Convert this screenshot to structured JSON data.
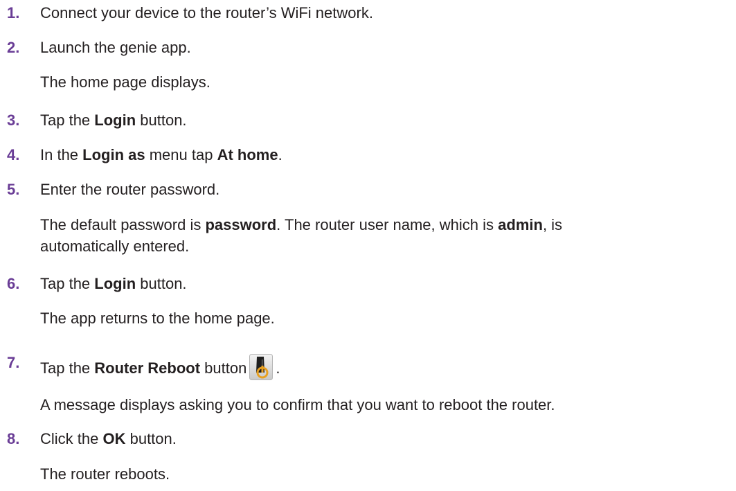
{
  "steps": [
    {
      "num": "1.",
      "parts": [
        "Connect your device to the router’s WiFi network."
      ]
    },
    {
      "num": "2.",
      "parts": [
        "Launch the genie app."
      ],
      "note": "The home page displays."
    },
    {
      "num": "3.",
      "parts": [
        "Tap the ",
        "Login",
        " button."
      ]
    },
    {
      "num": "4.",
      "parts": [
        "In the ",
        "Login as",
        " menu tap ",
        "At home",
        "."
      ]
    },
    {
      "num": "5.",
      "parts": [
        "Enter the router password."
      ],
      "note_parts": [
        "The default password is ",
        "password",
        ". The router user name, which is ",
        "admin",
        ", is"
      ],
      "note_line2": "automatically entered."
    },
    {
      "num": "6.",
      "parts": [
        "Tap the ",
        "Login",
        " button."
      ],
      "note": "The app returns to the home page."
    },
    {
      "num": "7.",
      "parts": [
        "Tap the ",
        "Router Reboot",
        " button",
        "."
      ],
      "note": "A message displays asking you to confirm that you want to reboot the router.",
      "icon": "router-reboot-icon"
    },
    {
      "num": "8.",
      "parts": [
        "Click the ",
        "OK",
        " button."
      ],
      "note": "The router reboots."
    }
  ],
  "colors": {
    "step_number": "#6a3d96",
    "text": "#231f20",
    "icon_accent": "#e8a020"
  }
}
